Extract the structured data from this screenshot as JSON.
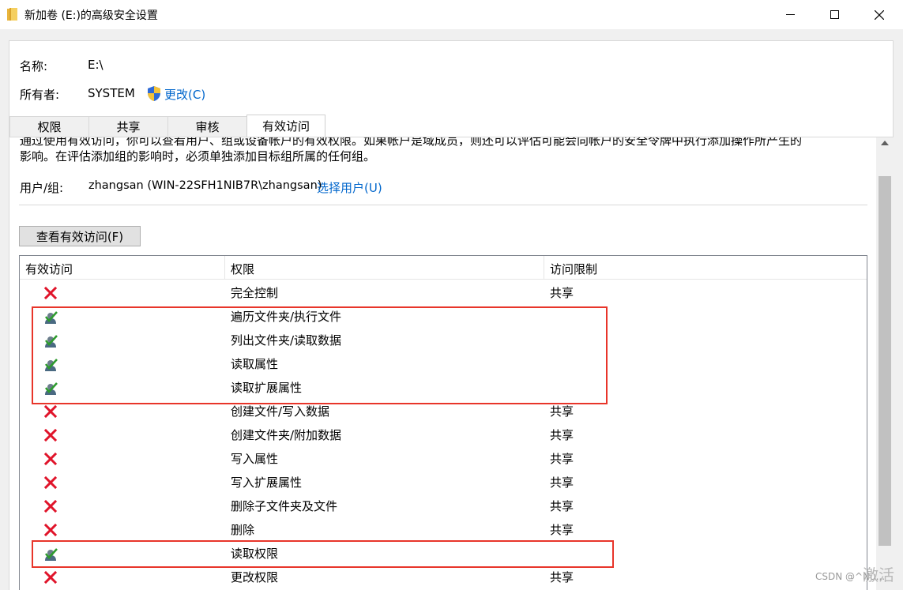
{
  "window": {
    "title": "新加卷 (E:)的高级安全设置"
  },
  "info": {
    "name_label": "名称:",
    "name_value": "E:\\",
    "owner_label": "所有者:",
    "owner_value": "SYSTEM",
    "change_link": "更改(C)"
  },
  "tabs": [
    {
      "label": "权限",
      "active": false
    },
    {
      "label": "共享",
      "active": false
    },
    {
      "label": "审核",
      "active": false
    },
    {
      "label": "有效访问",
      "active": true
    }
  ],
  "content": {
    "desc_line1": "通过使用有效访问，你可以查看用户、组或设备帐户的有效权限。如果帐户是域成员，则还可以评估可能会向帐户的安全令牌中执行添加操作所产生的",
    "desc_line2": "影响。在评估添加组的影响时，必须单独添加目标组所属的任何组。",
    "user_label": "用户/组:",
    "user_value": "zhangsan (WIN-22SFH1NIB7R\\zhangsan)",
    "select_user_link": "选择用户(U)",
    "view_button": "查看有效访问(F)"
  },
  "table": {
    "columns": [
      "有效访问",
      "权限",
      "访问限制"
    ],
    "rows": [
      {
        "allowed": false,
        "permission": "完全控制",
        "limit": "共享"
      },
      {
        "allowed": true,
        "permission": "遍历文件夹/执行文件",
        "limit": ""
      },
      {
        "allowed": true,
        "permission": "列出文件夹/读取数据",
        "limit": ""
      },
      {
        "allowed": true,
        "permission": "读取属性",
        "limit": ""
      },
      {
        "allowed": true,
        "permission": "读取扩展属性",
        "limit": ""
      },
      {
        "allowed": false,
        "permission": "创建文件/写入数据",
        "limit": "共享"
      },
      {
        "allowed": false,
        "permission": "创建文件夹/附加数据",
        "limit": "共享"
      },
      {
        "allowed": false,
        "permission": "写入属性",
        "limit": "共享"
      },
      {
        "allowed": false,
        "permission": "写入扩展属性",
        "limit": "共享"
      },
      {
        "allowed": false,
        "permission": "删除子文件夹及文件",
        "limit": "共享"
      },
      {
        "allowed": false,
        "permission": "删除",
        "limit": "共享"
      },
      {
        "allowed": true,
        "permission": "读取权限",
        "limit": ""
      },
      {
        "allowed": false,
        "permission": "更改权限",
        "limit": "共享"
      }
    ]
  },
  "colors": {
    "link": "#0066cc",
    "deny": "#e0142a",
    "highlight": "#e8352a"
  },
  "watermark": "CSDN @^Nu...",
  "watermark_logo": "激活"
}
